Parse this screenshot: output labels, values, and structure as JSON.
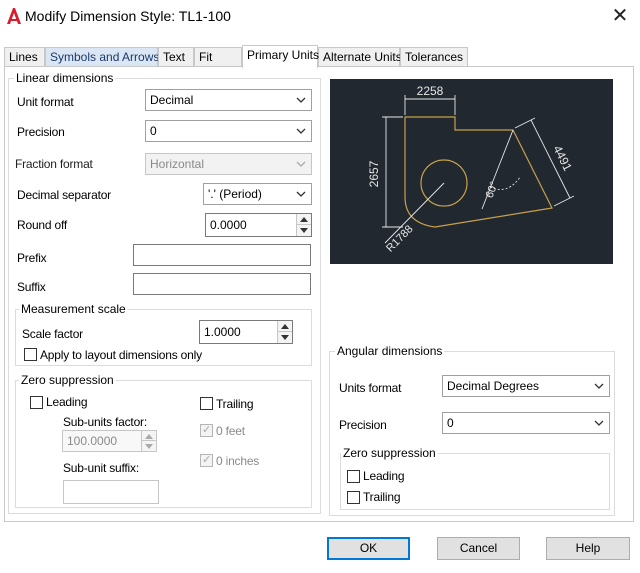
{
  "window": {
    "title": "Modify Dimension Style: TL1-100",
    "close": "✕"
  },
  "tabs": [
    "Lines",
    "Symbols and Arrows",
    "Text",
    "Fit",
    "Primary Units",
    "Alternate Units",
    "Tolerances"
  ],
  "linear": {
    "legend": "Linear dimensions",
    "unit_format_label": "Unit format",
    "unit_format_value": "Decimal",
    "precision_label": "Precision",
    "precision_value": "0",
    "fraction_format_label": "Fraction format",
    "fraction_format_value": "Horizontal",
    "decimal_separator_label": "Decimal separator",
    "decimal_separator_value": "'.' (Period)",
    "round_off_label": "Round off",
    "round_off_value": "0.0000",
    "prefix_label": "Prefix",
    "prefix_value": "",
    "suffix_label": "Suffix",
    "suffix_value": ""
  },
  "measurement_scale": {
    "legend": "Measurement scale",
    "scale_factor_label": "Scale factor",
    "scale_factor_value": "1.0000",
    "apply_layout_label": "Apply to layout dimensions only",
    "apply_layout_checked": false
  },
  "zero_suppression_linear": {
    "legend": "Zero suppression",
    "leading_label": "Leading",
    "trailing_label": "Trailing",
    "sub_units_factor_label": "Sub-units factor:",
    "sub_units_factor_value": "100.0000",
    "sub_unit_suffix_label": "Sub-unit suffix:",
    "sub_unit_suffix_value": "",
    "zero_feet_label": "0 feet",
    "zero_inches_label": "0 inches"
  },
  "preview": {
    "dim_2258": "2258",
    "dim_2657": "2657",
    "dim_4491": "4491",
    "dim_angle": "60°",
    "dim_radius": "R1788",
    "colors": {
      "background": "#212830",
      "geometry": "#c8a14a",
      "dimension": "#e6e6e6"
    }
  },
  "angular": {
    "legend": "Angular dimensions",
    "units_format_label": "Units format",
    "units_format_value": "Decimal Degrees",
    "precision_label": "Precision",
    "precision_value": "0"
  },
  "zero_suppression_angular": {
    "legend": "Zero suppression",
    "leading_label": "Leading",
    "trailing_label": "Trailing"
  },
  "buttons": {
    "ok": "OK",
    "cancel": "Cancel",
    "help": "Help"
  },
  "colors": {
    "accent": "#0078d7",
    "logo": "#d81e2c"
  }
}
